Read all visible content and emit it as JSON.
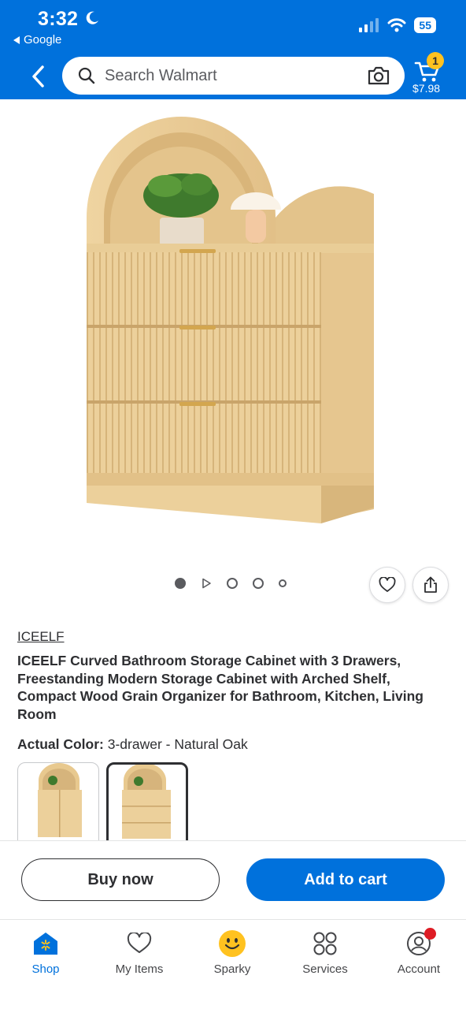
{
  "status_bar": {
    "time": "3:32",
    "back_app": "Google",
    "battery": "55"
  },
  "header": {
    "search_placeholder": "Search Walmart",
    "cart_count": "1",
    "cart_total": "$7.98"
  },
  "product": {
    "brand": "ICEELF",
    "title": "ICEELF Curved Bathroom Storage Cabinet with 3 Drawers, Freestanding Modern Storage Cabinet with Arched Shelf, Compact Wood Grain Organizer for Bathroom, Kitchen, Living Room",
    "color_label": "Actual Color:",
    "color_value": "3-drawer - Natural Oak",
    "gallery_active_index": 0
  },
  "actions": {
    "buy_now": "Buy now",
    "add_to_cart": "Add to cart"
  },
  "tabs": [
    {
      "label": "Shop",
      "icon": "shop-icon",
      "active": true
    },
    {
      "label": "My Items",
      "icon": "heart-icon",
      "active": false
    },
    {
      "label": "Sparky",
      "icon": "sparky-icon",
      "active": false
    },
    {
      "label": "Services",
      "icon": "services-grid-icon",
      "active": false
    },
    {
      "label": "Account",
      "icon": "account-icon",
      "active": false
    }
  ],
  "colors": {
    "brand_blue": "#0071dc",
    "spark_yellow": "#ffc220",
    "notify_red": "#de1c24",
    "wood": "#e8c98f"
  }
}
